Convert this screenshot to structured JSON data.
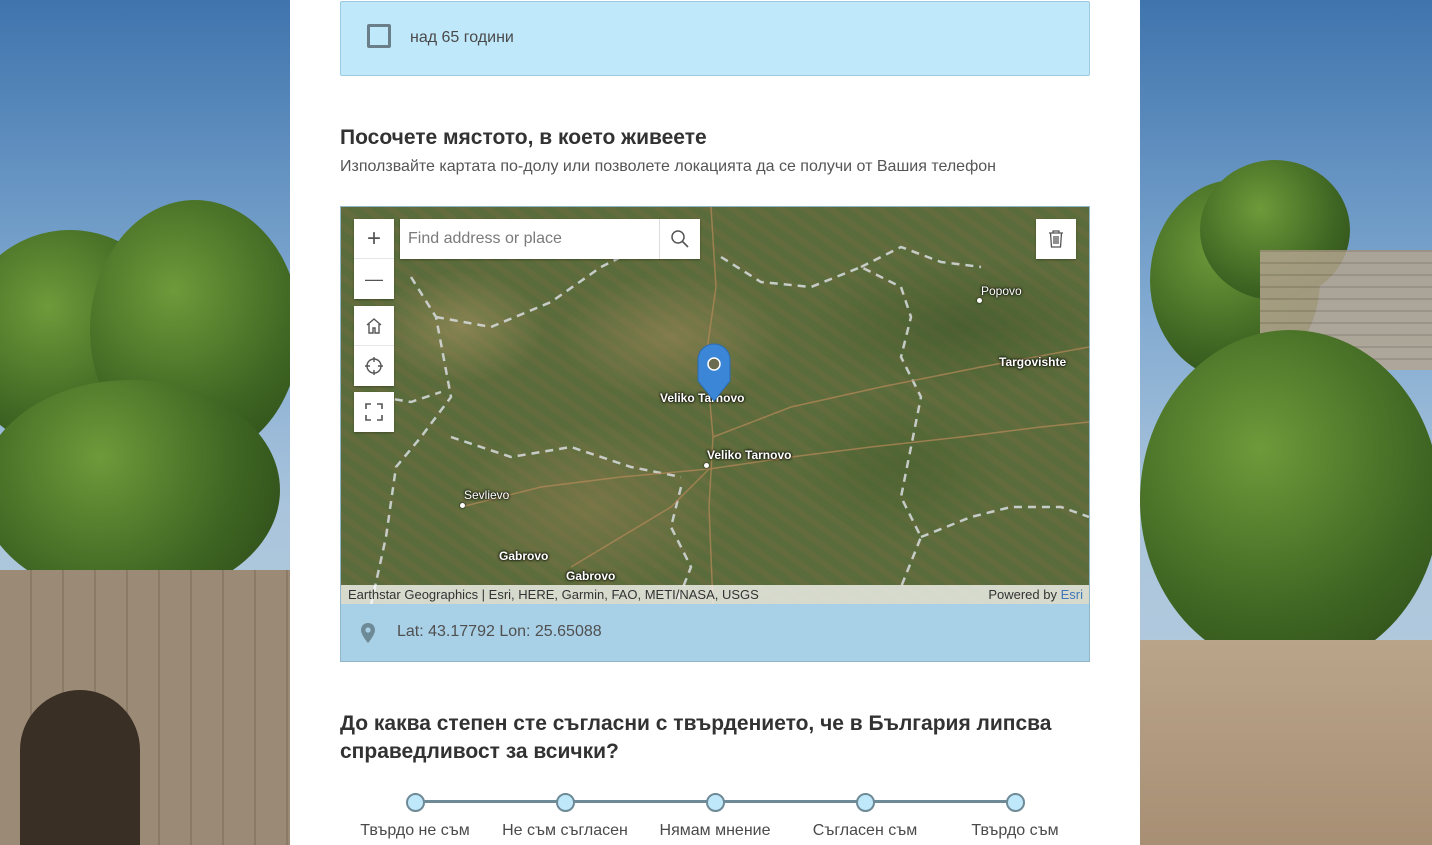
{
  "age_option": {
    "label": "над 65 години",
    "checked": false
  },
  "location_question": {
    "title": "Посочете мястото, в което живеете",
    "description": "Използвайте картата по-долу или позволете локацията да се получи от Вашия телефон"
  },
  "map": {
    "search_placeholder": "Find address or place",
    "zoom_in_label": "+",
    "zoom_out_label": "—",
    "places": [
      "Popovo",
      "Targovishte",
      "Veliko Tarnovo",
      "Veliko Tarnovo",
      "Sevlievo",
      "Gabrovo",
      "Gabrovo"
    ],
    "attribution": "Earthstar Geographics | Esri, HERE, Garmin, FAO, METI/NASA, USGS",
    "powered_by": "Powered by",
    "powered_by_link": "Esri"
  },
  "coordinates": {
    "text": "Lat: 43.17792  Lon: 25.65088"
  },
  "agreement_question": {
    "title_line1": "До каква степен сте съгласни с твърдението, че в България липсва",
    "title_line2": "справедливост за всички?",
    "options": [
      "Твърдо не съм",
      "Не съм съгласен",
      "Нямам мнение",
      "Съгласен съм",
      "Твърдо съм"
    ]
  },
  "colors": {
    "card_bg": "#bfe8fb",
    "coords_bg": "#a8d0e6",
    "esri_link": "#3f78b8",
    "pin": "#3b86d6"
  }
}
